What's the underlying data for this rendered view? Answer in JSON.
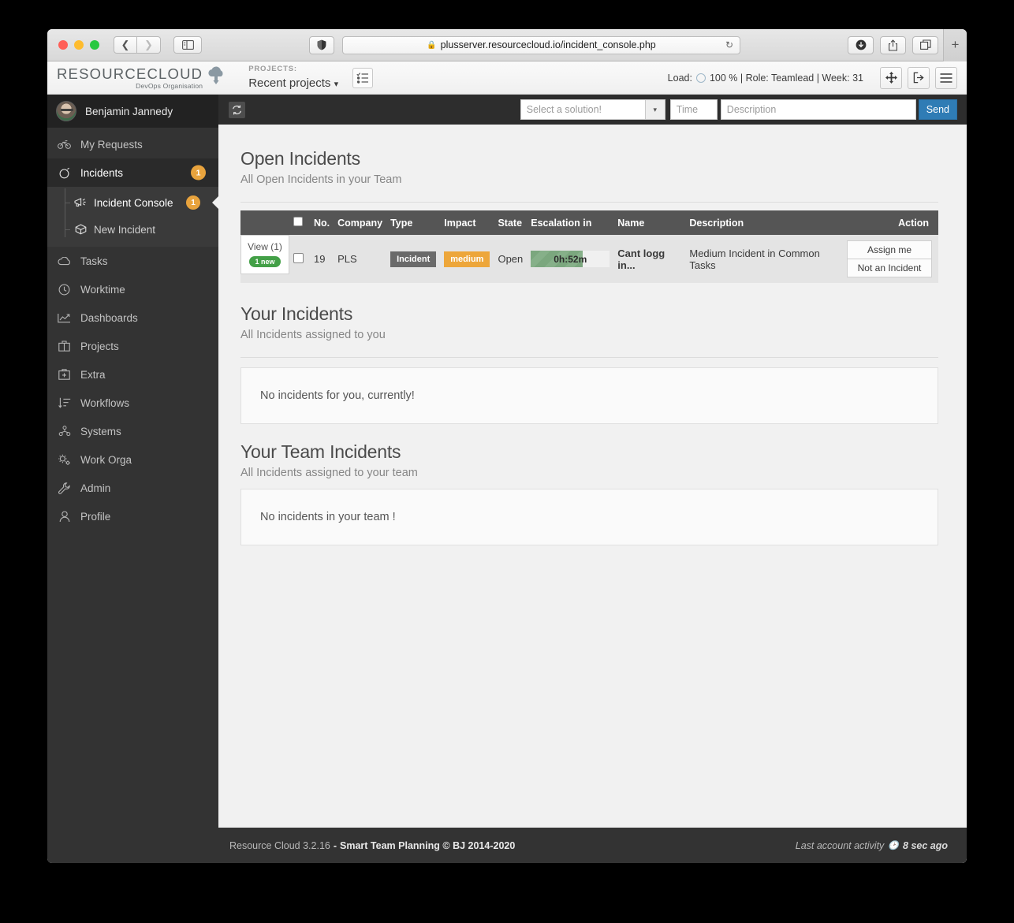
{
  "browser": {
    "url": "plusserver.resourcecloud.io/incident_console.php",
    "lock_icon": "lock-icon",
    "back_icon": "chevron-left-icon",
    "forward_icon": "chevron-right-icon",
    "sidebar_icon": "sidebar-toggle-icon",
    "shield_icon": "shield-icon",
    "reload_icon": "reload-icon",
    "download_icon": "download-icon",
    "share_icon": "share-icon",
    "tabs_icon": "tab-overview-icon",
    "newtab_label": "+"
  },
  "app_header": {
    "logo_main": "RESOURCECLOUD",
    "logo_sub": "DevOps Organisation",
    "logo_icon": "cloud-download-icon",
    "projects_label": "PROJECTS:",
    "projects_value": "Recent projects",
    "projects_caret": "chevron-down-icon",
    "checklist_icon": "checklist-icon",
    "status": "Load:   100 % | Role: Teamlead | Week: 31",
    "status_prefix": "Load:",
    "status_suffix": "100 % | Role: Teamlead | Week: 31",
    "move_icon": "move-arrows-icon",
    "logout_icon": "logout-icon",
    "menu_icon": "hamburger-menu-icon"
  },
  "sidebar": {
    "user": "Benjamin Jannedy",
    "avatar": "user-avatar",
    "items": [
      {
        "label": "My Requests",
        "icon": "bicycle-icon",
        "badge": null,
        "active": false
      },
      {
        "label": "Incidents",
        "icon": "alarm-clock-icon",
        "badge": "1",
        "active": true
      },
      {
        "label": "Tasks",
        "icon": "cloud-icon",
        "badge": null,
        "active": false
      },
      {
        "label": "Worktime",
        "icon": "clock-icon",
        "badge": null,
        "active": false
      },
      {
        "label": "Dashboards",
        "icon": "chart-line-icon",
        "badge": null,
        "active": false
      },
      {
        "label": "Projects",
        "icon": "briefcase-icon",
        "badge": null,
        "active": false
      },
      {
        "label": "Extra",
        "icon": "toolbox-icon",
        "badge": null,
        "active": false
      },
      {
        "label": "Workflows",
        "icon": "sort-list-icon",
        "badge": null,
        "active": false
      },
      {
        "label": "Systems",
        "icon": "network-nodes-icon",
        "badge": null,
        "active": false
      },
      {
        "label": "Work Orga",
        "icon": "gears-icon",
        "badge": null,
        "active": false
      },
      {
        "label": "Admin",
        "icon": "wrench-icon",
        "badge": null,
        "active": false
      },
      {
        "label": "Profile",
        "icon": "person-icon",
        "badge": null,
        "active": false
      }
    ],
    "subitems": [
      {
        "label": "Incident Console",
        "icon": "megaphone-icon",
        "badge": "1",
        "current": true
      },
      {
        "label": "New Incident",
        "icon": "box-icon",
        "badge": null,
        "current": false
      }
    ]
  },
  "topbar": {
    "sync_icon": "sync-refresh-icon",
    "solution_placeholder": "Select a solution!",
    "solution_caret": "chevron-down-icon",
    "time_placeholder": "Time",
    "description_placeholder": "Description",
    "send_label": "Send"
  },
  "sections": {
    "open": {
      "title": "Open Incidents",
      "subtitle": "All Open Incidents in your Team"
    },
    "yours": {
      "title": "Your Incidents",
      "subtitle": "All Incidents assigned to you",
      "empty": "No incidents for you, currently!"
    },
    "team": {
      "title": "Your Team Incidents",
      "subtitle": "All Incidents assigned to your team",
      "empty": "No incidents in your team !"
    }
  },
  "table": {
    "columns": [
      "",
      "",
      "No.",
      "Company",
      "Type",
      "Impact",
      "State",
      "Escalation in",
      "Name",
      "Description",
      "Action"
    ],
    "header_checkbox": "select-all-checkbox",
    "rows": [
      {
        "view_label": "View (1)",
        "view_badge": "1 new",
        "checkbox": "row-checkbox",
        "no": "19",
        "company": "PLS",
        "type": "Incident",
        "impact": "medium",
        "state": "Open",
        "escalation": "0h:52m",
        "escalation_percent": 66,
        "name": "Cant logg in...",
        "description": "Medium Incident in Common Tasks",
        "actions": [
          "Assign me",
          "Not an Incident"
        ]
      }
    ]
  },
  "footer": {
    "version": "Resource Cloud 3.2.16",
    "dash": "-",
    "copyright": "Smart Team Planning © BJ 2014-2020",
    "activity_label": "Last account activity",
    "activity_icon": "clock-icon",
    "activity_value": "8 sec ago"
  },
  "colors": {
    "sidebar_bg": "#333333",
    "sidebar_active": "#2a2a2a",
    "subgroup_bg": "#3a3a3a",
    "badge_orange": "#e8a33d",
    "impact_orange": "#eda63a",
    "type_gray": "#6a6a6a",
    "new_green": "#43a047",
    "escalation_green": "#86b089",
    "send_blue": "#2f7cb5",
    "table_header": "#555555",
    "row_bg": "#e4e4e4",
    "content_bg": "#f1f1f1"
  }
}
